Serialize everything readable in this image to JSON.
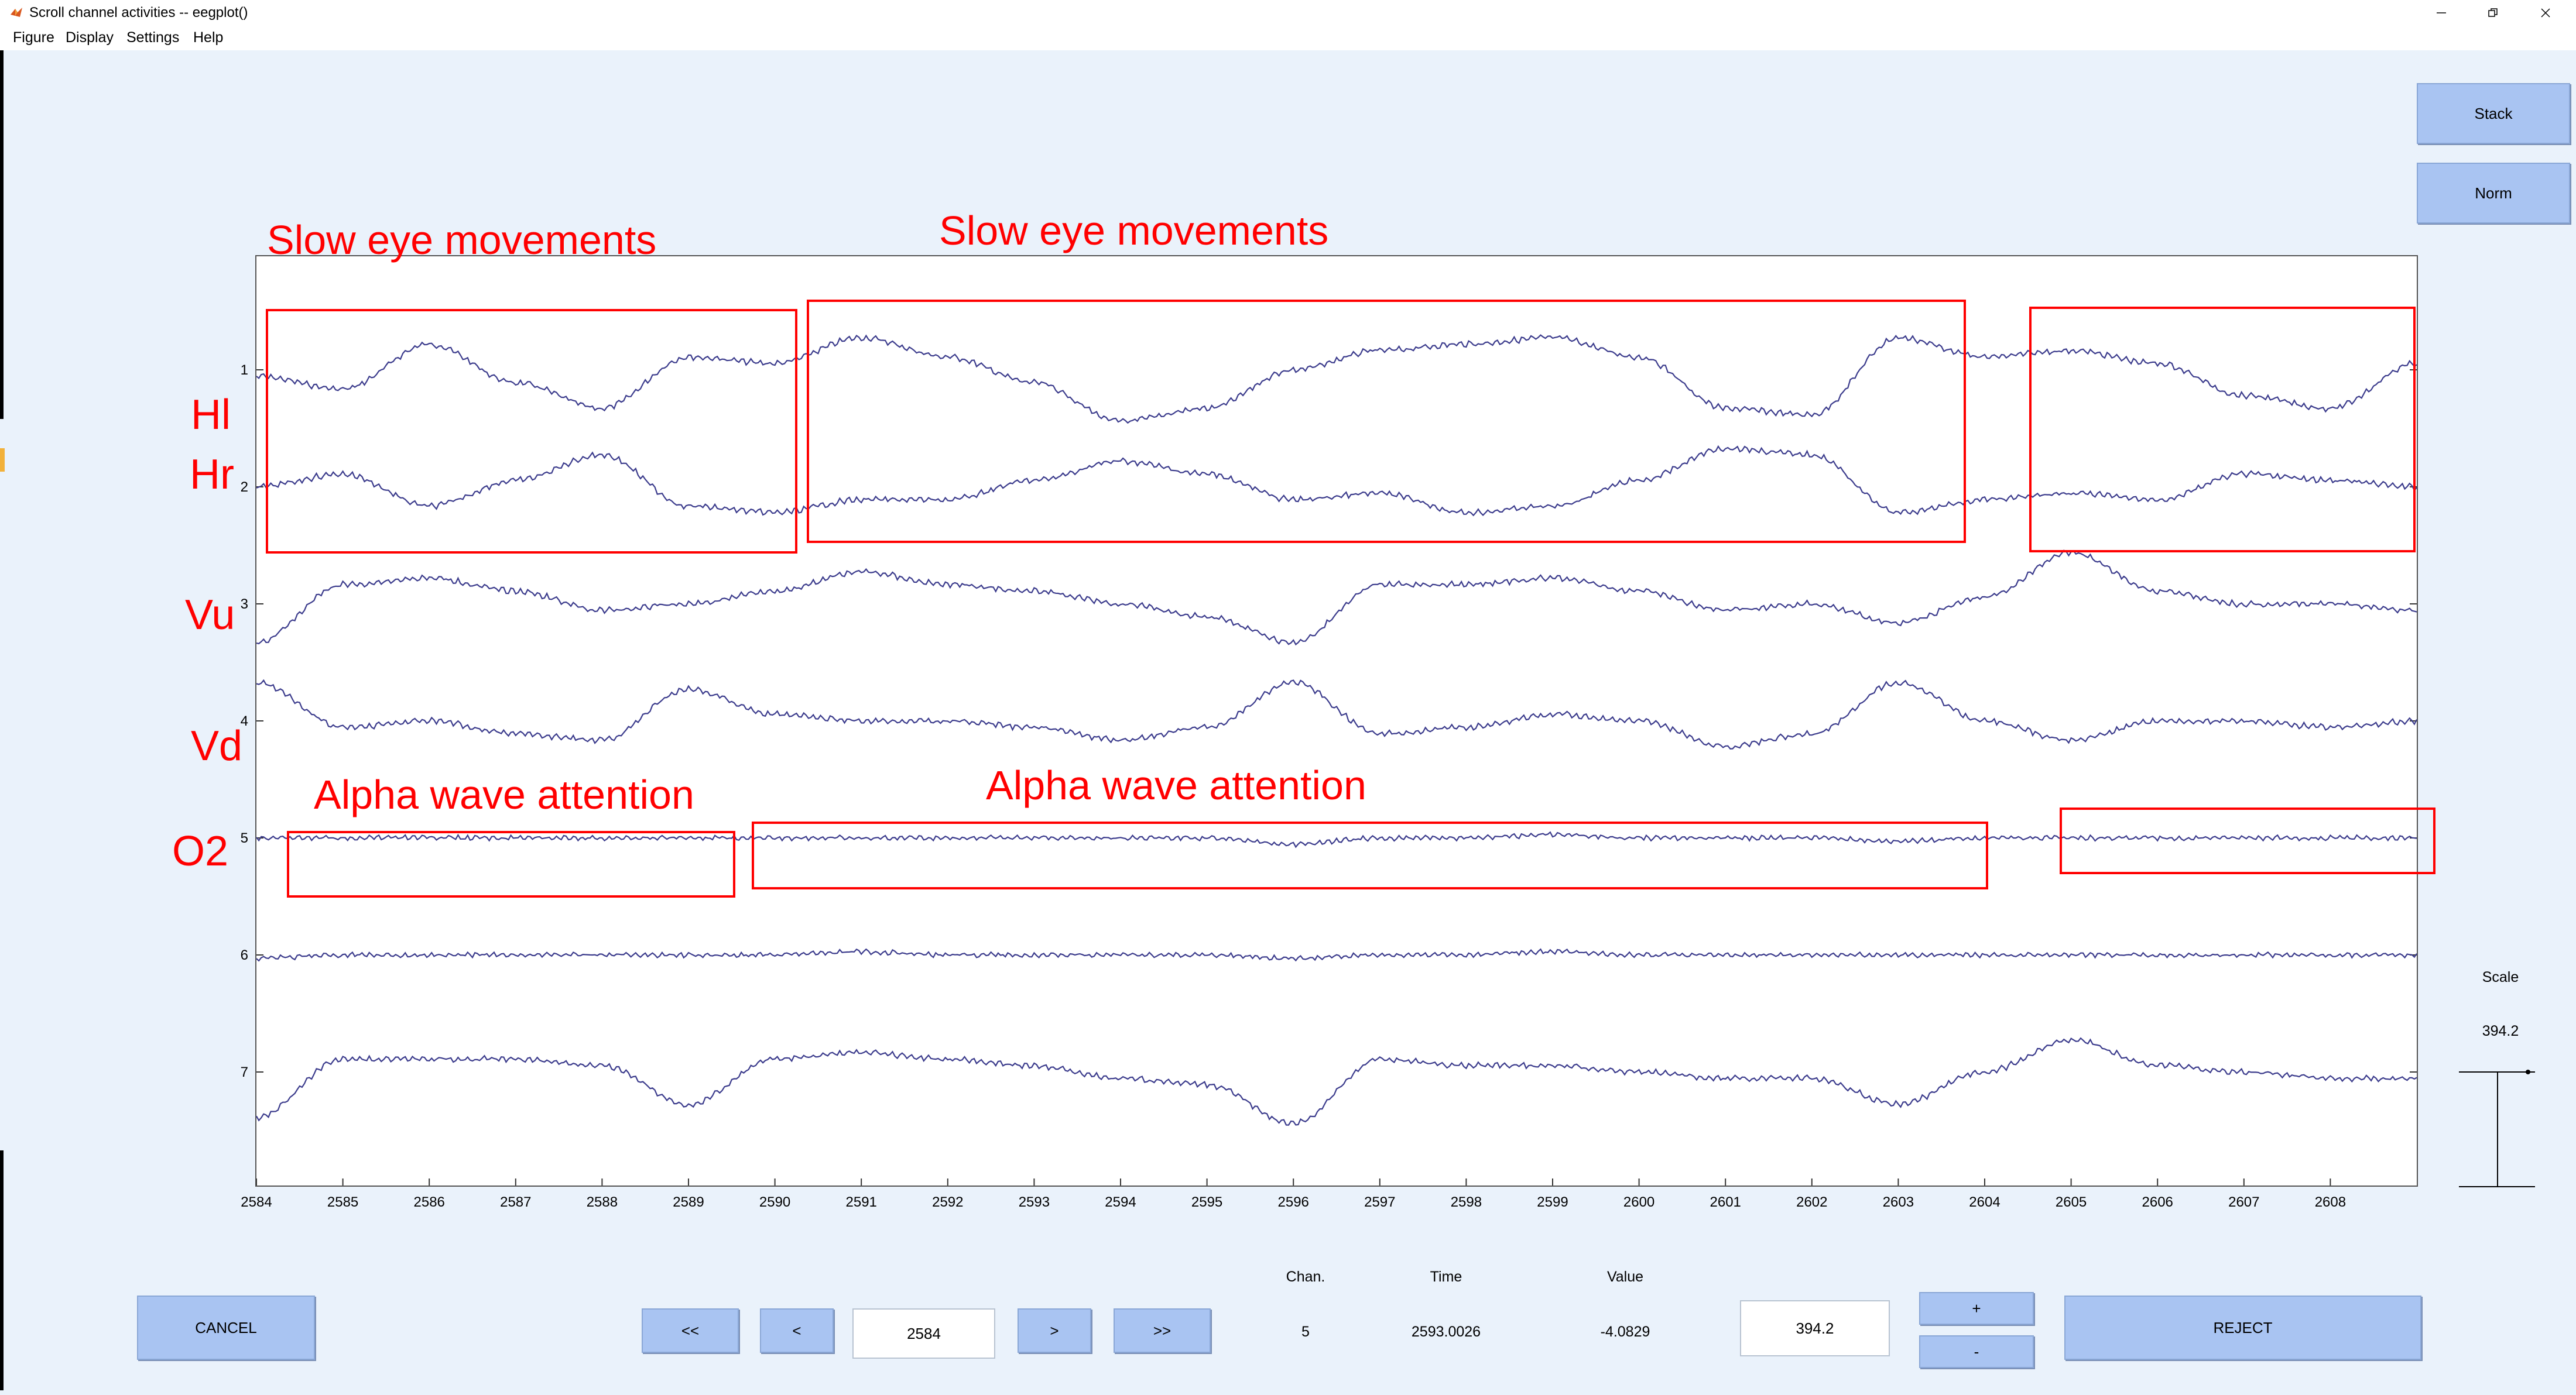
{
  "window": {
    "title": "Scroll channel activities -- eegplot()",
    "menu": [
      "Figure",
      "Display",
      "Settings",
      "Help"
    ]
  },
  "buttons": {
    "stack": "Stack",
    "norm": "Norm",
    "cancel": "CANCEL",
    "reject": "REJECT",
    "prev_page": "<<",
    "prev": "<",
    "next": ">",
    "next_page": ">>",
    "scale_up": "+",
    "scale_down": "-"
  },
  "fields": {
    "time_start": "2584",
    "scale_value": "394.2"
  },
  "scale_panel": {
    "label": "Scale",
    "value": "394.2"
  },
  "readout": {
    "chan_label": "Chan.",
    "time_label": "Time",
    "value_label": "Value",
    "chan": "5",
    "time": "2593.0026",
    "value": "-4.0829"
  },
  "annotations": {
    "slow_eye_1": "Slow eye movements",
    "slow_eye_2": "Slow eye movements",
    "alpha_1": "Alpha wave attention",
    "alpha_2": "Alpha wave attention",
    "channel_names": [
      "Hl",
      "Hr",
      "Vu",
      "Vd",
      "O2"
    ]
  },
  "colors": {
    "trace": "#3b3b8c",
    "annotation": "#ff0000",
    "button": "#a9c4f2",
    "figure_bg": "#eaf2fb"
  },
  "chart_data": {
    "type": "line",
    "x_ticks": [
      "2584",
      "2585",
      "2586",
      "2587",
      "2588",
      "2589",
      "2590",
      "2591",
      "2592",
      "2593",
      "2594",
      "2595",
      "2596",
      "2597",
      "2598",
      "2599",
      "2600",
      "2601",
      "2602",
      "2603",
      "2604",
      "2605",
      "2606",
      "2607",
      "2608"
    ],
    "y_ticks": [
      "1",
      "2",
      "3",
      "4",
      "5",
      "6",
      "7"
    ],
    "xlim": [
      2584,
      2609
    ],
    "grid": false,
    "series": [
      {
        "channel": 1,
        "x": [
          2584,
          2585,
          2586,
          2587,
          2588,
          2589,
          2590,
          2591,
          2592,
          2593,
          2594,
          2595,
          2596,
          2597,
          2598,
          2599,
          2600,
          2601,
          2602,
          2603,
          2604,
          2605,
          2606,
          2607,
          2608,
          2609
        ],
        "y": [
          -0.1,
          -0.3,
          0.4,
          -0.2,
          -0.6,
          0.2,
          0.1,
          0.5,
          0.2,
          -0.2,
          -0.8,
          -0.6,
          0.0,
          0.3,
          0.4,
          0.5,
          0.2,
          -0.6,
          -0.7,
          0.5,
          0.2,
          0.3,
          0.1,
          -0.4,
          -0.6,
          0.1
        ]
      },
      {
        "channel": 2,
        "x": [
          2584,
          2585,
          2586,
          2587,
          2588,
          2589,
          2590,
          2591,
          2592,
          2593,
          2594,
          2595,
          2596,
          2597,
          2598,
          2599,
          2600,
          2601,
          2602,
          2603,
          2604,
          2605,
          2606,
          2607,
          2608,
          2609
        ],
        "y": [
          0.0,
          0.2,
          -0.3,
          0.1,
          0.5,
          -0.3,
          -0.4,
          -0.2,
          -0.2,
          0.1,
          0.4,
          0.2,
          -0.2,
          -0.1,
          -0.4,
          -0.3,
          0.1,
          0.6,
          0.5,
          -0.4,
          -0.2,
          -0.1,
          -0.2,
          0.2,
          0.1,
          0.0
        ]
      },
      {
        "channel": 3,
        "x": [
          2584,
          2585,
          2586,
          2587,
          2588,
          2589,
          2590,
          2591,
          2592,
          2593,
          2594,
          2595,
          2596,
          2597,
          2598,
          2599,
          2600,
          2601,
          2602,
          2603,
          2604,
          2605,
          2606,
          2607,
          2608,
          2609
        ],
        "y": [
          -0.6,
          0.3,
          0.4,
          0.2,
          -0.1,
          0.0,
          0.2,
          0.5,
          0.3,
          0.2,
          0.0,
          -0.2,
          -0.6,
          0.3,
          0.3,
          0.4,
          0.2,
          -0.1,
          0.0,
          -0.3,
          0.1,
          0.8,
          0.2,
          0.0,
          0.0,
          -0.1
        ]
      },
      {
        "channel": 4,
        "x": [
          2584,
          2585,
          2586,
          2587,
          2588,
          2589,
          2590,
          2591,
          2592,
          2593,
          2594,
          2595,
          2596,
          2597,
          2598,
          2599,
          2600,
          2601,
          2602,
          2603,
          2604,
          2605,
          2606,
          2607,
          2608,
          2609
        ],
        "y": [
          0.6,
          -0.1,
          0.0,
          -0.2,
          -0.3,
          0.5,
          0.1,
          0.0,
          0.0,
          -0.1,
          -0.3,
          -0.1,
          0.6,
          -0.2,
          -0.1,
          0.1,
          0.0,
          -0.4,
          -0.2,
          0.6,
          0.0,
          -0.3,
          0.0,
          0.0,
          -0.1,
          0.0
        ]
      },
      {
        "channel": 5,
        "x": [
          2584,
          2585,
          2586,
          2587,
          2588,
          2589,
          2590,
          2591,
          2592,
          2593,
          2594,
          2595,
          2596,
          2597,
          2598,
          2599,
          2600,
          2601,
          2602,
          2603,
          2604,
          2605,
          2606,
          2607,
          2608,
          2609
        ],
        "y": [
          0.0,
          0.0,
          0.0,
          0.0,
          0.0,
          0.0,
          0.0,
          0.0,
          0.0,
          0.0,
          0.0,
          0.0,
          -0.1,
          0.0,
          0.0,
          0.05,
          0.0,
          0.0,
          0.0,
          -0.05,
          0.0,
          0.0,
          0.0,
          0.0,
          0.0,
          0.0
        ]
      },
      {
        "channel": 6,
        "x": [
          2584,
          2585,
          2586,
          2587,
          2588,
          2589,
          2590,
          2591,
          2592,
          2593,
          2594,
          2595,
          2596,
          2597,
          2598,
          2599,
          2600,
          2601,
          2602,
          2603,
          2604,
          2605,
          2606,
          2607,
          2608,
          2609
        ],
        "y": [
          -0.05,
          0.0,
          0.0,
          0.0,
          0.0,
          0.0,
          0.0,
          0.05,
          0.0,
          0.0,
          0.0,
          0.0,
          -0.05,
          0.0,
          0.0,
          0.05,
          0.0,
          0.0,
          0.0,
          0.0,
          0.0,
          0.0,
          0.0,
          0.0,
          0.0,
          0.0
        ]
      },
      {
        "channel": 7,
        "x": [
          2584,
          2585,
          2586,
          2587,
          2588,
          2589,
          2590,
          2591,
          2592,
          2593,
          2594,
          2595,
          2596,
          2597,
          2598,
          2599,
          2600,
          2601,
          2602,
          2603,
          2604,
          2605,
          2606,
          2607,
          2608,
          2609
        ],
        "y": [
          -0.7,
          0.2,
          0.2,
          0.2,
          0.1,
          -0.5,
          0.2,
          0.3,
          0.2,
          0.1,
          -0.1,
          -0.2,
          -0.8,
          0.2,
          0.1,
          0.1,
          0.0,
          -0.1,
          -0.1,
          -0.5,
          0.0,
          0.5,
          0.1,
          0.0,
          -0.1,
          -0.1
        ]
      }
    ]
  }
}
